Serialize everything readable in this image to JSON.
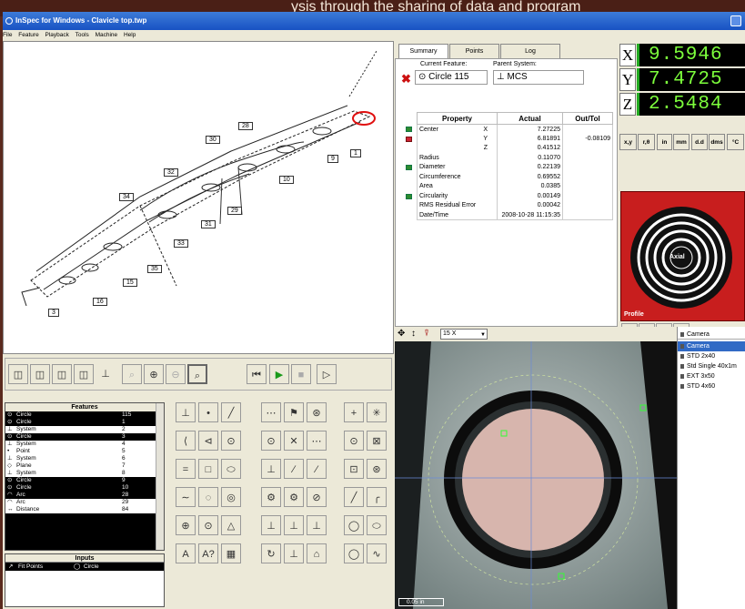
{
  "background_caption": "ysis through the sharing of data and program",
  "window": {
    "title": "InSpec for Windows - Clavicle top.twp"
  },
  "menu": [
    "File",
    "Feature",
    "Playback",
    "Tools",
    "Machine",
    "Help"
  ],
  "drawing": {
    "labels": [
      {
        "id": "28"
      },
      {
        "id": "30"
      },
      {
        "id": "1"
      },
      {
        "id": "9"
      },
      {
        "id": "32"
      },
      {
        "id": "10"
      },
      {
        "id": "34"
      },
      {
        "id": "29"
      },
      {
        "id": "31"
      },
      {
        "id": "33"
      },
      {
        "id": "35"
      },
      {
        "id": "15"
      },
      {
        "id": "16"
      },
      {
        "id": "3"
      }
    ]
  },
  "summary": {
    "tabs": [
      "Summary",
      "Points",
      "Log"
    ],
    "current_feature_label": "Current Feature:",
    "parent_system_label": "Parent System:",
    "current_feature": "Circle 115",
    "parent_system": "MCS",
    "table_headers": [
      "Property",
      "Actual",
      "Out/Tol"
    ],
    "rows": [
      {
        "prop": "Center",
        "axis": "X",
        "actual": "7.27225",
        "outtol": "",
        "status": "ok"
      },
      {
        "prop": "",
        "axis": "Y",
        "actual": "6.81891",
        "outtol": "-0.08109",
        "status": "bad"
      },
      {
        "prop": "",
        "axis": "Z",
        "actual": "0.41512",
        "outtol": "",
        "status": ""
      },
      {
        "prop": "Radius",
        "axis": "",
        "actual": "0.11070",
        "outtol": "",
        "status": ""
      },
      {
        "prop": "Diameter",
        "axis": "",
        "actual": "0.22139",
        "outtol": "",
        "status": "ok"
      },
      {
        "prop": "Circumference",
        "axis": "",
        "actual": "0.69552",
        "outtol": "",
        "status": ""
      },
      {
        "prop": "Area",
        "axis": "",
        "actual": "0.0385",
        "outtol": "",
        "status": ""
      },
      {
        "prop": "Circularity",
        "axis": "",
        "actual": "0.00149",
        "outtol": "",
        "status": "ok"
      },
      {
        "prop": "RMS Residual Error",
        "axis": "",
        "actual": "0.00042",
        "outtol": "",
        "status": ""
      },
      {
        "prop": "Date/Time",
        "axis": "",
        "actual": "2008-10-28 11:15:35",
        "outtol": "",
        "status": ""
      }
    ]
  },
  "dro": {
    "axes": [
      {
        "axis": "X",
        "value": "9.5946"
      },
      {
        "axis": "Y",
        "value": "7.4725"
      },
      {
        "axis": "Z",
        "value": "2.5484"
      }
    ],
    "buttons": [
      "x,y",
      "r,θ",
      "in",
      "mm",
      "d.d",
      "dms",
      "°C"
    ],
    "target_label": "Axial",
    "profile_label": "Profile"
  },
  "features": {
    "header": "Features",
    "items": [
      {
        "type": "Circle",
        "id": "115",
        "sel": true
      },
      {
        "type": "Circle",
        "id": "1",
        "sel": true
      },
      {
        "type": "System",
        "id": "2",
        "sel": false
      },
      {
        "type": "Circle",
        "id": "3",
        "sel": true
      },
      {
        "type": "System",
        "id": "4",
        "sel": false
      },
      {
        "type": "Point",
        "id": "5",
        "sel": false
      },
      {
        "type": "System",
        "id": "6",
        "sel": false
      },
      {
        "type": "Plane",
        "id": "7",
        "sel": false
      },
      {
        "type": "System",
        "id": "8",
        "sel": false
      },
      {
        "type": "Circle",
        "id": "9",
        "sel": true
      },
      {
        "type": "Circle",
        "id": "10",
        "sel": true
      },
      {
        "type": "Arc",
        "id": "28",
        "sel": true
      },
      {
        "type": "Arc",
        "id": "29",
        "sel": false
      },
      {
        "type": "Distance",
        "id": "84",
        "sel": false
      }
    ]
  },
  "inputs": {
    "header": "Inputs",
    "row_label": "Fit Points",
    "row_value": "Circle"
  },
  "video": {
    "zoom": "15 X",
    "scale_label": "0.05 in",
    "camera_header": "Camera",
    "cameras": [
      "Camera",
      "STD 2x40",
      "Std Single 40x1m",
      "EXT 3x50",
      "STD 4x60"
    ]
  }
}
